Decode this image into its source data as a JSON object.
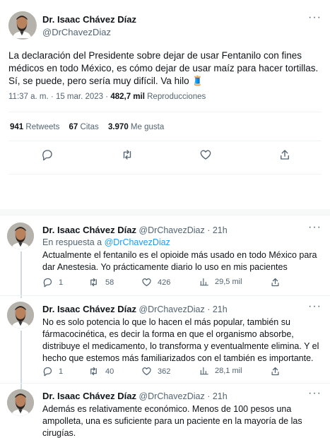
{
  "main": {
    "author_name": "Dr. Isaac Chávez Díaz",
    "author_handle": "@DrChavezDiaz",
    "text": "La declaración del Presidente sobre dejar de usar Fentanilo con fines médicos en todo México, es cómo dejar de usar maíz para hacer tortillas. Sí, se puede, pero sería muy difícil. Va hilo 🧵",
    "time": "11:37 a. m.",
    "dot": "·",
    "date": "15 mar. 2023",
    "views_count": "482,7 mil",
    "views_label": "Reproducciones",
    "retweets_count": "941",
    "retweets_label": "Retweets",
    "quotes_count": "67",
    "quotes_label": "Citas",
    "likes_count": "3.970",
    "likes_label": "Me gusta"
  },
  "replies": [
    {
      "author_name": "Dr. Isaac Chávez Díaz",
      "author_handle": "@DrChavezDiaz",
      "age": "· 21h",
      "in_reply_prefix": "En respuesta a",
      "in_reply_handle": "@DrChavezDiaz",
      "text": "Actualmente el fentanilo es el opioide más usado en todo México para dar Anestesia. Yo prácticamente diario lo uso en mis pacientes",
      "reply_count": "1",
      "retweet_count": "58",
      "like_count": "426",
      "view_count": "29,5 mil"
    },
    {
      "author_name": "Dr. Isaac Chávez Díaz",
      "author_handle": "@DrChavezDiaz",
      "age": "· 21h",
      "text": "No es solo potencia lo que lo hacen el más popular, también su fármacocinética, es decir la forma en que el organismo absorbe, distribuye el medicamento, lo transforma y eventualmente elimina. Y el hecho que estemos más familiarizados con el también es importante.",
      "reply_count": "1",
      "retweet_count": "40",
      "like_count": "362",
      "view_count": "28,1 mil"
    },
    {
      "author_name": "Dr. Isaac Chávez Díaz",
      "author_handle": "@DrChavezDiaz",
      "age": "· 21h",
      "text": "Además es relativamente económico. Menos de 100 pesos una ampolleta, una es suficiente para un paciente en la mayoría de las cirugías."
    }
  ],
  "icons": {
    "more": "more-dots-icon",
    "reply": "reply-bubble-icon",
    "retweet": "retweet-arrows-icon",
    "like": "heart-icon",
    "share": "share-upload-icon",
    "views": "views-bars-icon"
  },
  "colors": {
    "accent": "#1d9bf0",
    "text": "#0f1419",
    "muted": "#536471",
    "divider": "#eff3f4"
  },
  "more_glyph": "···"
}
